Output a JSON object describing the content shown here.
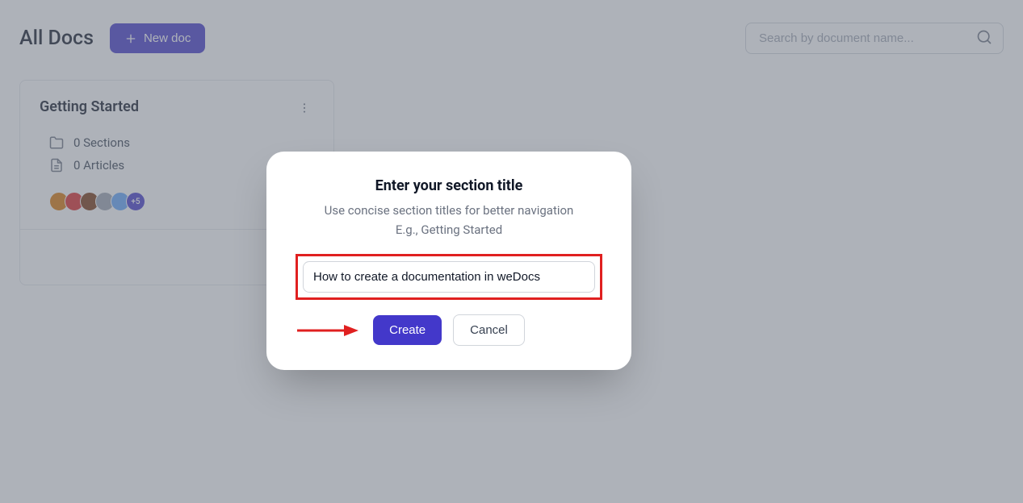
{
  "header": {
    "title": "All Docs",
    "new_doc_label": "New doc",
    "search_placeholder": "Search by document name..."
  },
  "card": {
    "title": "Getting Started",
    "sections_label": "0 Sections",
    "articles_label": "0 Articles",
    "avatars": [
      {
        "bg": "#D97706"
      },
      {
        "bg": "#DC2626"
      },
      {
        "bg": "#78350F"
      },
      {
        "bg": "#9CA3AF"
      },
      {
        "bg": "#60A5FA"
      }
    ],
    "more_count": "+5"
  },
  "modal": {
    "title": "Enter your section title",
    "subtitle_line1": "Use concise section titles for better navigation",
    "subtitle_line2": "E.g., Getting Started",
    "input_value": "How to create a documentation in weDocs",
    "create_label": "Create",
    "cancel_label": "Cancel"
  }
}
